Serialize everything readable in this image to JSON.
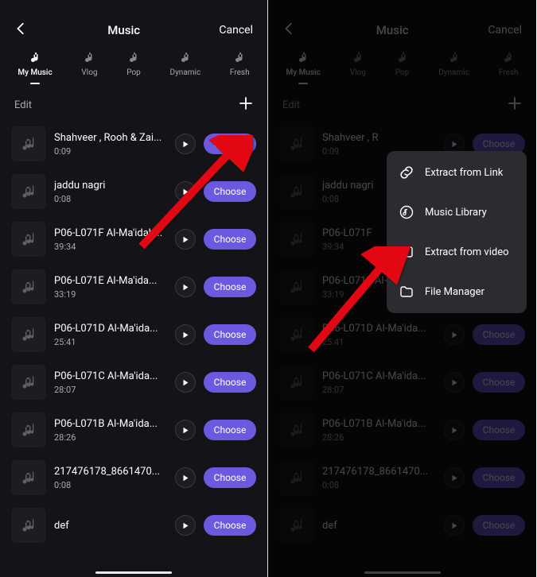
{
  "header": {
    "title": "Music",
    "cancel": "Cancel"
  },
  "tabs": [
    {
      "label": "My Music"
    },
    {
      "label": "Vlog"
    },
    {
      "label": "Pop"
    },
    {
      "label": "Dynamic"
    },
    {
      "label": "Fresh"
    }
  ],
  "toolbar": {
    "edit": "Edit"
  },
  "choose_label": "Choose",
  "songs": [
    {
      "title": "Shahveer , Rooh & Zai...",
      "dur": "0:09"
    },
    {
      "title": "jaddu nagri",
      "dur": "0:08"
    },
    {
      "title": "P06-L071F Al-Ma'idah...",
      "dur": "39:34"
    },
    {
      "title": "P06-L071E Al-Ma'ida...",
      "dur": "33:19"
    },
    {
      "title": "P06-L071D Al-Ma'ida...",
      "dur": "25:41"
    },
    {
      "title": "P06-L071C Al-Ma'ida...",
      "dur": "28:07"
    },
    {
      "title": "P06-L071B Al-Ma'ida...",
      "dur": "28:26"
    },
    {
      "title": "217476178_8661470...",
      "dur": "0:08"
    },
    {
      "title": "def",
      "dur": ""
    }
  ],
  "songs_right_visible": [
    {
      "title": "Shahveer , R",
      "dur": "0:09"
    },
    {
      "title": "jaddu nagri",
      "dur": "0:08"
    },
    {
      "title": "P06-L071F",
      "dur": "39:34"
    },
    {
      "title": "P06-L071E Al-Ma'ida...",
      "dur": "33:19"
    },
    {
      "title": "P06-L071D Al-Ma'ida...",
      "dur": "25:41"
    },
    {
      "title": "P06-L071C Al-Ma'ida...",
      "dur": "28:07"
    },
    {
      "title": "P06-L071B Al-Ma'ida...",
      "dur": "28:26"
    },
    {
      "title": "217476178_8661470...",
      "dur": "0:08"
    },
    {
      "title": "def",
      "dur": ""
    }
  ],
  "popup": [
    {
      "label": "Extract from Link"
    },
    {
      "label": "Music Library"
    },
    {
      "label": "Extract from video"
    },
    {
      "label": "File Manager"
    }
  ]
}
